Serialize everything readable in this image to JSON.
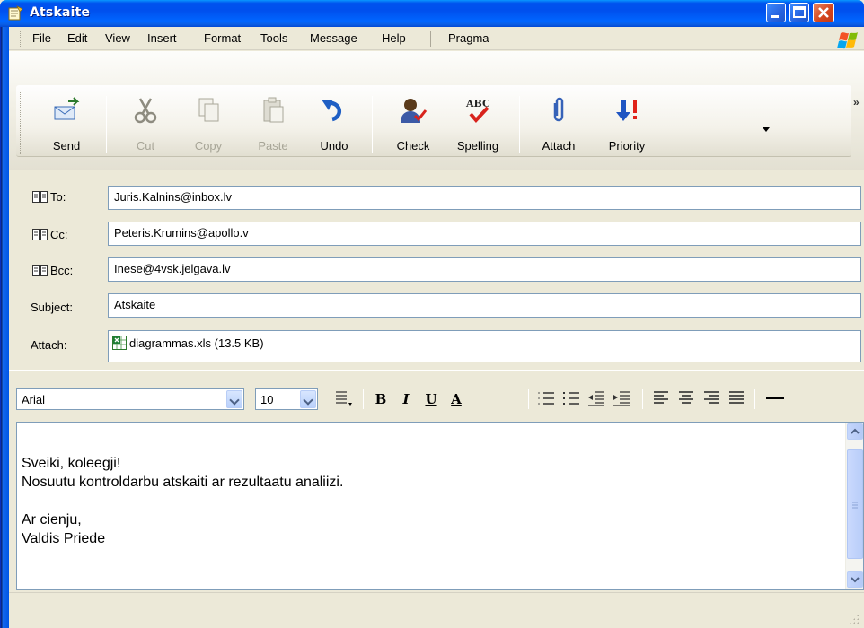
{
  "window": {
    "title": "Atskaite"
  },
  "menu": [
    "File",
    "Edit",
    "View",
    "Insert",
    "Format",
    "Tools",
    "Message",
    "Help",
    "Pragma"
  ],
  "toolbar": {
    "send": "Send",
    "cut": "Cut",
    "copy": "Copy",
    "paste": "Paste",
    "undo": "Undo",
    "check": "Check",
    "spelling": "Spelling",
    "attach": "Attach",
    "priority": "Priority"
  },
  "fields": {
    "to_label": "To:",
    "to_value": "Juris.Kalnins@inbox.lv",
    "cc_label": "Cc:",
    "cc_value": "Peteris.Krumins@apollo.v",
    "bcc_label": "Bcc:",
    "bcc_value": "Inese@4vsk.jelgava.lv",
    "subject_label": "Subject:",
    "subject_value": "Atskaite",
    "attach_label": "Attach:",
    "attach_value": "diagrammas.xls (13.5 KB)"
  },
  "format": {
    "font": "Arial",
    "size": "10",
    "bold": "B",
    "italic": "I",
    "underline": "U",
    "font_color": "A"
  },
  "body": {
    "lines": [
      "Sveiki, koleegji!",
      "Nosuutu kontroldarbu atskaiti ar rezultaatu analiizi.",
      "",
      "Ar cienju,",
      "Valdis Priede"
    ]
  },
  "colors": {
    "titlebar": "#0053ee",
    "chrome": "#ece9d8",
    "field_border": "#7f9db9"
  }
}
